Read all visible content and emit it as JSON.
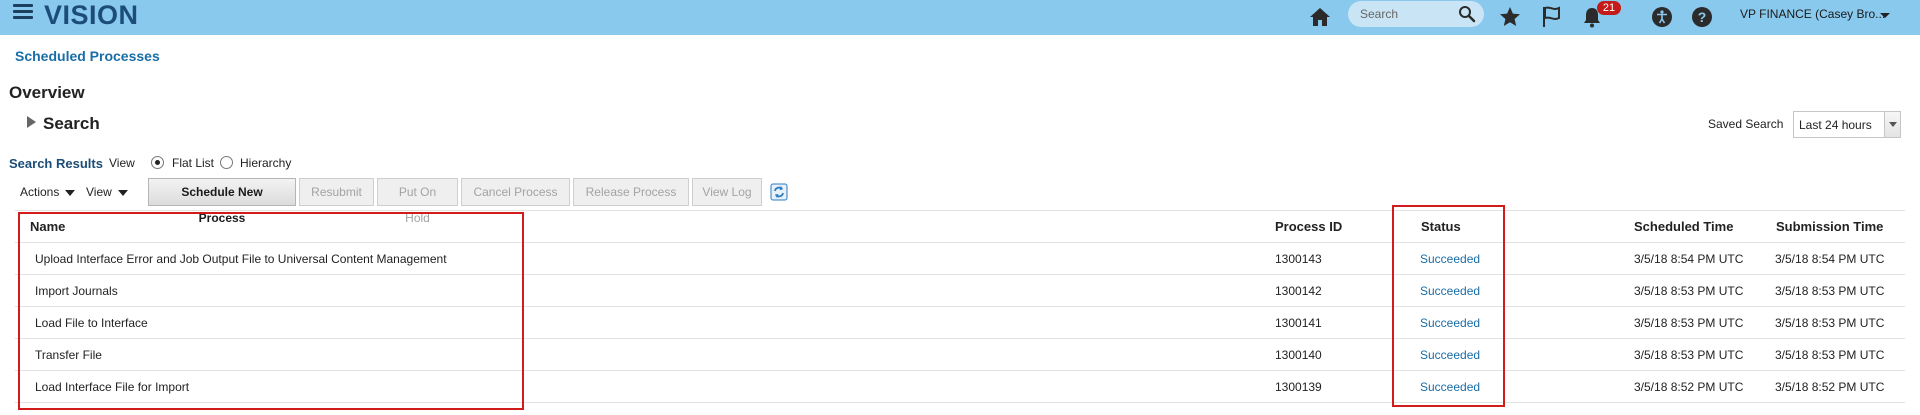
{
  "app": {
    "logo": "VISION",
    "search_placeholder": "Search",
    "notification_count": "21",
    "user_menu": "VP FINANCE (Casey Bro..."
  },
  "icons": {
    "menu": "hamburger-icon",
    "home": "home-icon",
    "search": "magnifier-icon",
    "favorites": "star-icon",
    "watchlist": "flag-icon",
    "notifications": "bell-icon",
    "accessibility": "accessibility-icon",
    "help": "help-icon",
    "refresh": "refresh-icon"
  },
  "colors": {
    "topbar": "#8ac9ee",
    "link": "#1a6ea8",
    "highlight": "#d21b1b",
    "badge": "#c41a1a"
  },
  "page": {
    "breadcrumb": "Scheduled Processes",
    "title": "Overview",
    "search_section": "Search",
    "saved_search_label": "Saved Search",
    "saved_search_value": "Last 24 hours"
  },
  "results": {
    "label": "Search Results",
    "view_label": "View",
    "view_options": [
      "Flat List",
      "Hierarchy"
    ],
    "selected_view": "Flat List"
  },
  "toolbar": {
    "actions": "Actions",
    "view": "View",
    "buttons": [
      "Schedule New Process",
      "Resubmit",
      "Put On Hold",
      "Cancel Process",
      "Release Process",
      "View Log"
    ]
  },
  "table": {
    "columns": [
      "Name",
      "Process ID",
      "Status",
      "Scheduled Time",
      "Submission Time"
    ],
    "rows": [
      {
        "name": "Upload Interface Error and Job Output File to Universal Content Management",
        "id": "1300143",
        "status": "Succeeded",
        "scheduled": "3/5/18 8:54 PM UTC",
        "submitted": "3/5/18 8:54 PM UTC"
      },
      {
        "name": "Import Journals",
        "id": "1300142",
        "status": "Succeeded",
        "scheduled": "3/5/18 8:53 PM UTC",
        "submitted": "3/5/18 8:53 PM UTC"
      },
      {
        "name": "Load File to Interface",
        "id": "1300141",
        "status": "Succeeded",
        "scheduled": "3/5/18 8:53 PM UTC",
        "submitted": "3/5/18 8:53 PM UTC"
      },
      {
        "name": "Transfer File",
        "id": "1300140",
        "status": "Succeeded",
        "scheduled": "3/5/18 8:53 PM UTC",
        "submitted": "3/5/18 8:53 PM UTC"
      },
      {
        "name": "Load Interface File for Import",
        "id": "1300139",
        "status": "Succeeded",
        "scheduled": "3/5/18 8:52 PM UTC",
        "submitted": "3/5/18 8:52 PM UTC"
      }
    ]
  }
}
